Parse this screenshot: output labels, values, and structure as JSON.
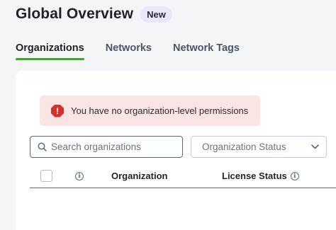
{
  "header": {
    "title": "Global Overview",
    "badge": "New"
  },
  "tabs": [
    {
      "label": "Organizations",
      "active": true
    },
    {
      "label": "Networks",
      "active": false
    },
    {
      "label": "Network Tags",
      "active": false
    }
  ],
  "alert": {
    "icon": "alert-octagon-icon",
    "text": "You have no organization-level permissions",
    "color": "#d0322d"
  },
  "search": {
    "placeholder": "Search organizations",
    "value": ""
  },
  "filter": {
    "label": "Organization Status"
  },
  "table": {
    "columns": [
      {
        "type": "checkbox"
      },
      {
        "type": "info-icon"
      },
      {
        "label": "Organization"
      },
      {
        "label": "License Status",
        "info": true
      }
    ]
  },
  "colors": {
    "accent": "#4a9a3a",
    "alert_bg": "#fbe4e4",
    "badge_bg": "#e9e8fb"
  }
}
